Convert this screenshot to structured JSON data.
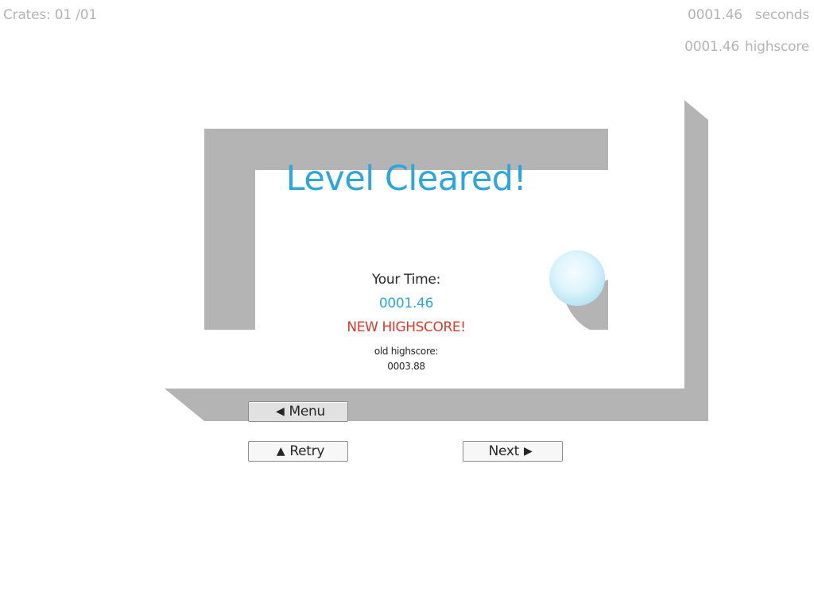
{
  "hud": {
    "crates": "Crates: 01 /01",
    "time_value": "0001.46",
    "time_unit": "seconds",
    "highscore_value": "0001.46",
    "highscore_unit": "highscore"
  },
  "dialog": {
    "title": "Level Cleared!",
    "your_time_label": "Your Time:",
    "your_time_value": "0001.46",
    "new_highscore": "NEW HIGHSCORE!",
    "old_highscore_label": "old highscore:",
    "old_highscore_value": "0003.88"
  },
  "buttons": {
    "menu": {
      "label": "Menu",
      "icon": "arrow-left-icon"
    },
    "retry": {
      "label": "Retry",
      "icon": "arrow-up-icon"
    },
    "next": {
      "label": "Next",
      "icon": "arrow-right-icon"
    }
  },
  "colors": {
    "accent_blue": "#2ea6dc",
    "highscore_red": "#d63a2e",
    "wall_gray": "#b4b4b4",
    "hud_gray": "#b4b4b4",
    "ball_color": "#cfeefa"
  }
}
